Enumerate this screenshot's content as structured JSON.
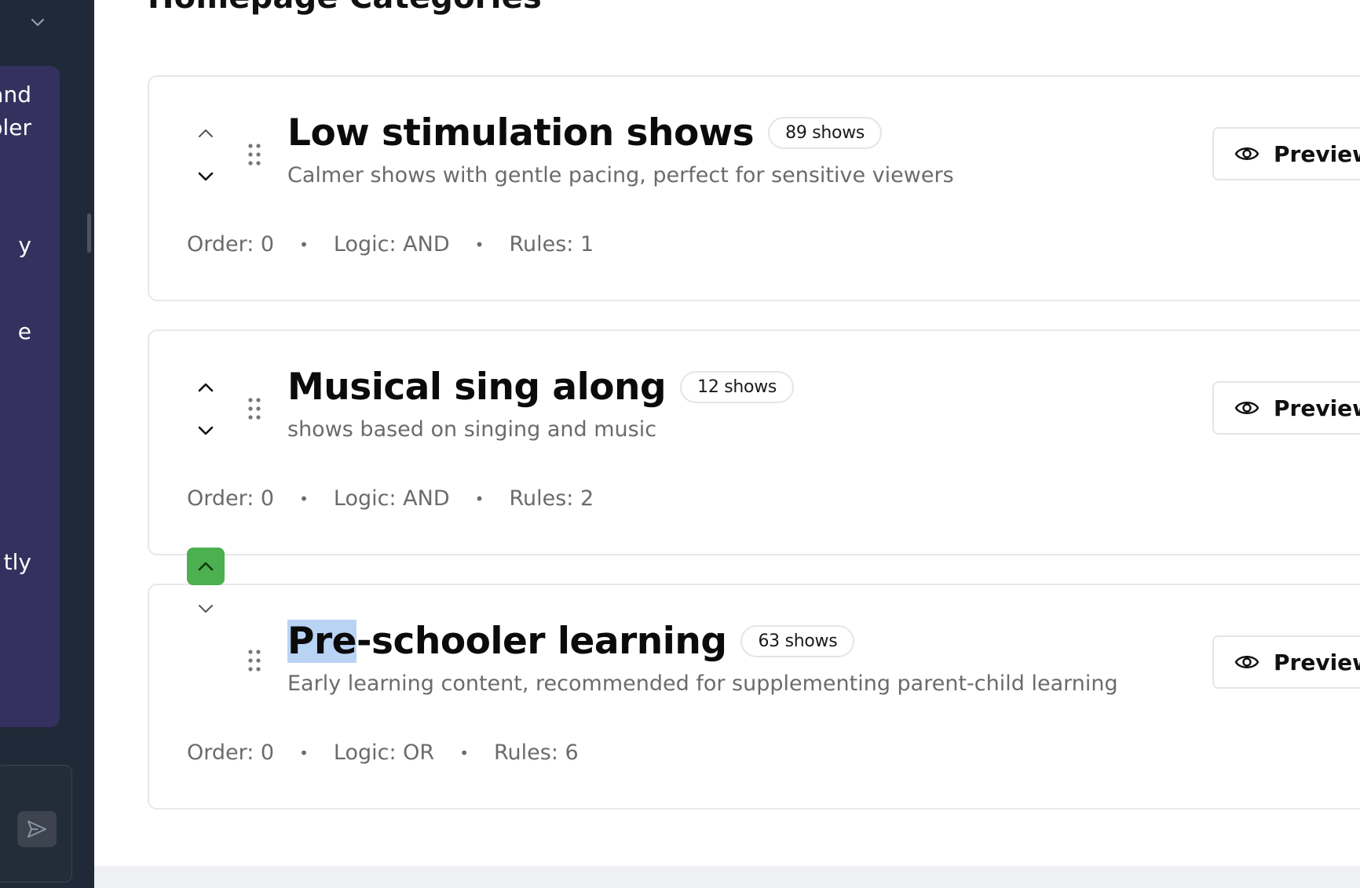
{
  "sidebar": {
    "chat_fragments": [
      "and",
      "bler",
      "y",
      "e",
      "tly"
    ]
  },
  "page": {
    "title": "Homepage Categories"
  },
  "categories": [
    {
      "title": "Low stimulation shows",
      "title_selected_prefix": "",
      "count": "89 shows",
      "description": "Calmer shows with gentle pacing, perfect for sensitive viewers",
      "order": "Order: 0",
      "logic": "Logic: AND",
      "rules": "Rules: 1",
      "preview_label": "Preview"
    },
    {
      "title": "Musical sing along",
      "title_selected_prefix": "",
      "count": "12 shows",
      "description": "shows based on singing and music",
      "order": "Order: 0",
      "logic": "Logic: AND",
      "rules": "Rules: 2",
      "preview_label": "Preview"
    },
    {
      "title_selected_prefix": "Pre",
      "title": "-schooler learning",
      "count": "63 shows",
      "description": "Early learning content, recommended for supplementing parent-child learning",
      "order": "Order: 0",
      "logic": "Logic: OR",
      "rules": "Rules: 6",
      "preview_label": "Preview"
    }
  ],
  "icons": {
    "move_up": "chevron-up-icon",
    "move_down": "chevron-down-icon",
    "drag": "grip-dots-icon",
    "preview": "eye-icon",
    "send": "send-icon"
  },
  "colors": {
    "sidebar_bg": "#1f2937",
    "chat_panel_bg": "#35315e",
    "active_move_button": "#4caf50",
    "selection_highlight": "#b9d3f5"
  }
}
